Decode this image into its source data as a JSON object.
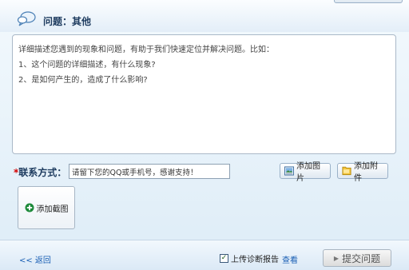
{
  "header": {
    "title": "问题：其他",
    "icon": "chat-bubble-icon"
  },
  "description": {
    "lines": [
      "详细描述您遇到的现象和问题，有助于我们快速定位并解决问题。比如：",
      "1、这个问题的详细描述，有什么现象?",
      "2、是如何产生的，造成了什么影响?"
    ]
  },
  "contact": {
    "required_mark": "*",
    "label": "联系方式：",
    "value": "请留下您的QQ或手机号，感谢支持！"
  },
  "buttons": {
    "add_picture": "添加图片",
    "add_attachment": "添加附件",
    "add_screenshot": "添加截图"
  },
  "footer": {
    "back": "<< 返回",
    "upload_report": "上传诊断报告",
    "upload_checked": true,
    "view": "查看",
    "submit": "提交问题"
  },
  "colors": {
    "title": "#1c3a5e",
    "link": "#1a5fb4",
    "required": "#d40000",
    "add_screenshot_icon": "#1d8a3a"
  }
}
